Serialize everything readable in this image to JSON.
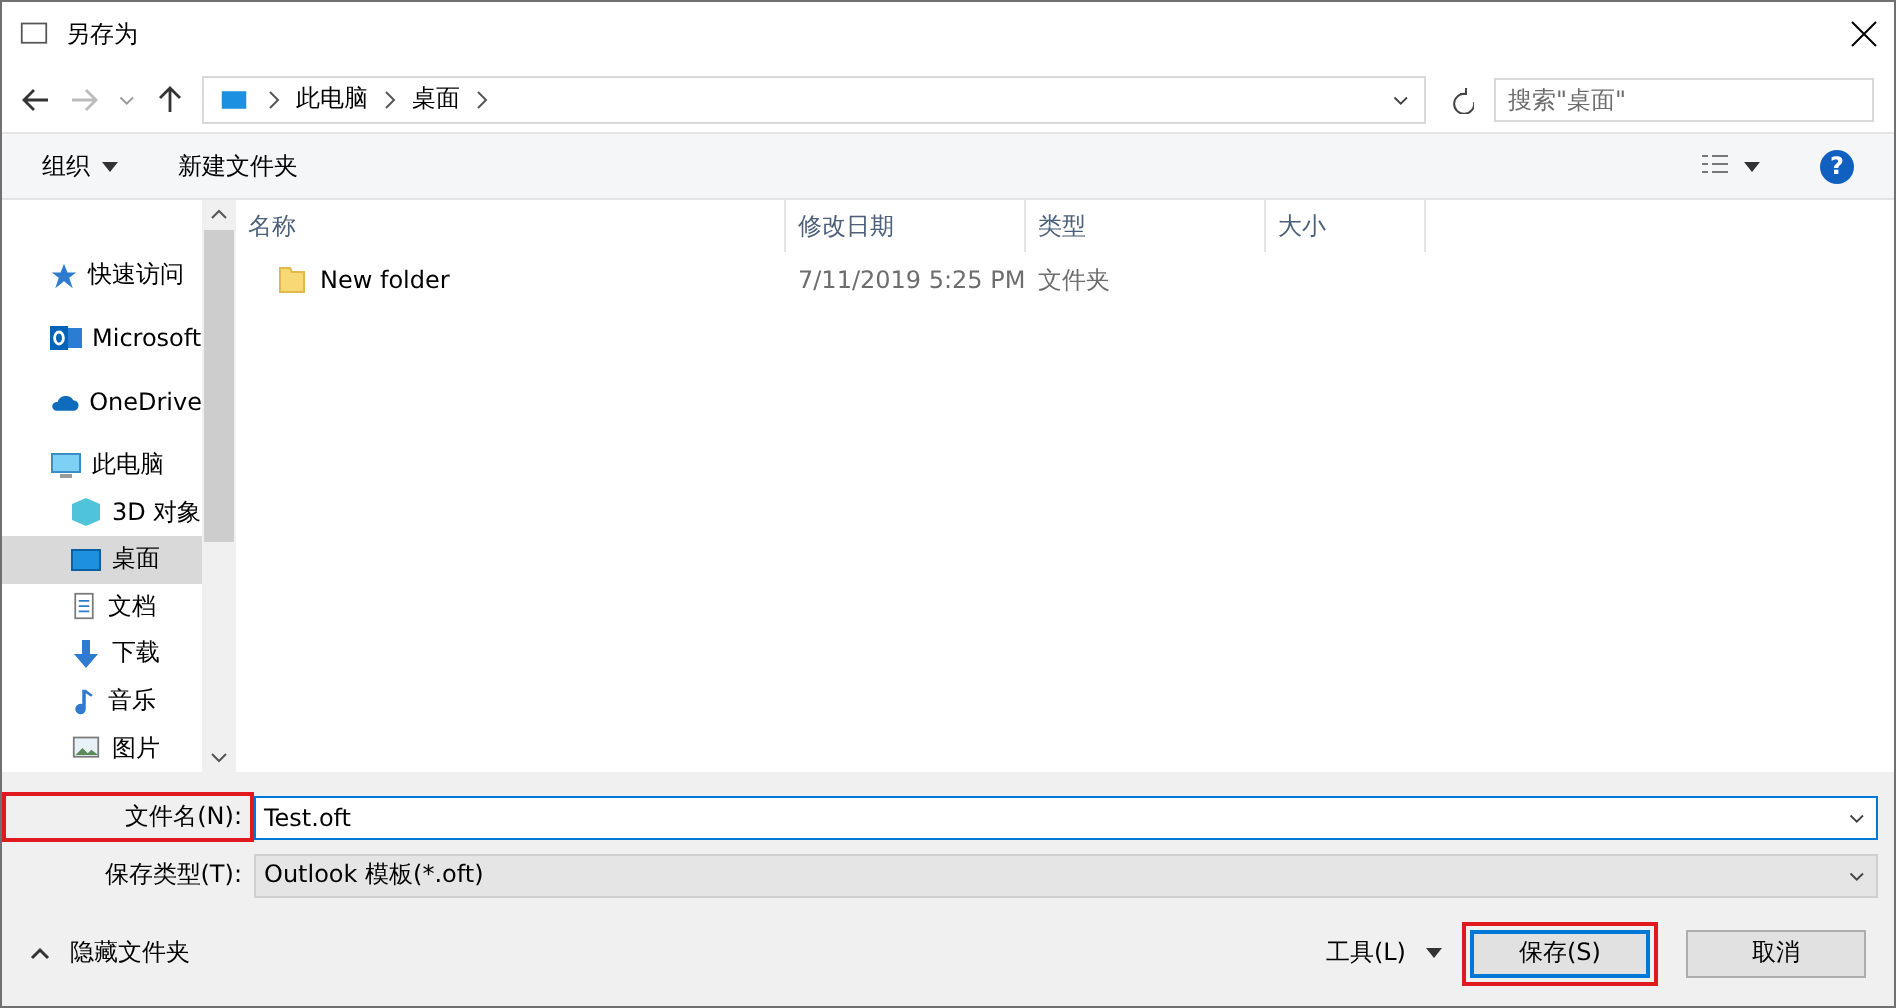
{
  "window": {
    "title": "另存为"
  },
  "breadcrumb": [
    "此电脑",
    "桌面"
  ],
  "search": {
    "placeholder": "搜索\"桌面\""
  },
  "toolbar": {
    "organize": "组织",
    "new_folder": "新建文件夹",
    "help": "?"
  },
  "sidebar": {
    "items": [
      {
        "label": "快速访问",
        "kind": "group",
        "selected": false
      },
      {
        "label": "Microsoft",
        "kind": "group",
        "selected": false
      },
      {
        "label": "OneDrive",
        "kind": "group",
        "selected": false
      },
      {
        "label": "此电脑",
        "kind": "group",
        "selected": false
      },
      {
        "label": "3D 对象",
        "kind": "child",
        "selected": false
      },
      {
        "label": "桌面",
        "kind": "child",
        "selected": true
      },
      {
        "label": "文档",
        "kind": "child",
        "selected": false
      },
      {
        "label": "下载",
        "kind": "child",
        "selected": false
      },
      {
        "label": "音乐",
        "kind": "child",
        "selected": false
      },
      {
        "label": "图片",
        "kind": "child",
        "selected": false
      }
    ]
  },
  "table": {
    "columns": [
      "名称",
      "修改日期",
      "类型",
      "大小"
    ],
    "rows": [
      {
        "name": "New folder",
        "date": "7/11/2019 5:25 PM",
        "type": "文件夹"
      }
    ]
  },
  "filename": {
    "label": "文件名(N):",
    "value": "Test.oft",
    "highlighted": true
  },
  "filetype": {
    "label": "保存类型(T):",
    "value": "Outlook 模板(*.oft)",
    "highlighted": false
  },
  "footer": {
    "hide_folders": "隐藏文件夹",
    "tools": "工具(L)",
    "buttons": [
      {
        "label": "保存(S)",
        "default": true,
        "highlighted": true
      },
      {
        "label": "取消",
        "default": false,
        "highlighted": false
      }
    ]
  }
}
